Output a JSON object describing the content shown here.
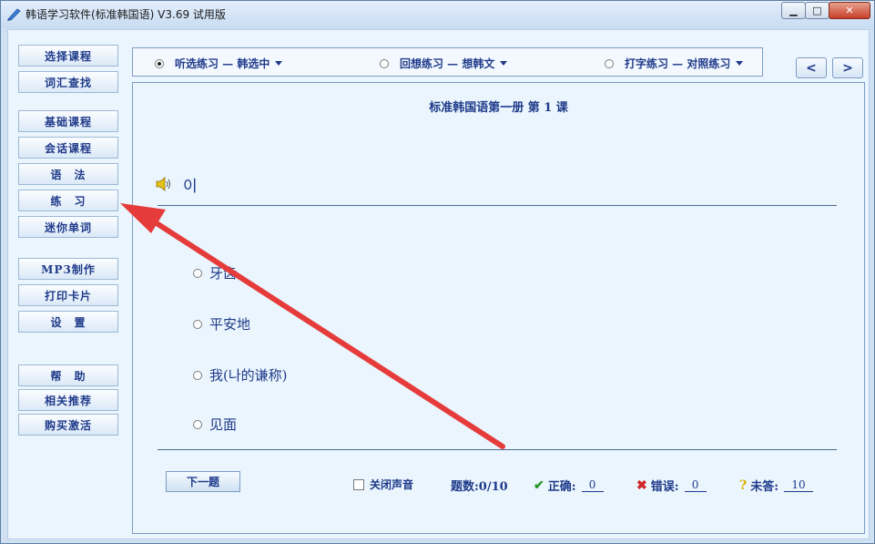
{
  "window": {
    "title": "韩语学习软件(标准韩国语) V3.69 试用版",
    "minimize": "▁",
    "maximize": "□",
    "close": "✕"
  },
  "sidebar": {
    "items": [
      {
        "label": "选择课程"
      },
      {
        "label": "词汇查找"
      },
      {
        "label": "基础课程"
      },
      {
        "label": "会话课程"
      },
      {
        "label": "语　法"
      },
      {
        "label": "练　习"
      },
      {
        "label": "迷你单词"
      },
      {
        "label": "MP3制作"
      },
      {
        "label": "打印卡片"
      },
      {
        "label": "设　置"
      },
      {
        "label": "帮　助"
      },
      {
        "label": "相关推荐"
      },
      {
        "label": "购买激活"
      }
    ]
  },
  "modes": [
    {
      "label": "听选练习 — 韩选中",
      "checked": true
    },
    {
      "label": "回想练习 — 想韩文",
      "checked": false
    },
    {
      "label": "打字练习 — 对照练习",
      "checked": false
    }
  ],
  "nav": {
    "prev": "<",
    "next": ">"
  },
  "main": {
    "lesson_title": "标准韩国语第一册 第 1 课",
    "question_word": "이",
    "choices": [
      "牙齿",
      "平安地",
      "我(나的谦称)",
      "见面"
    ]
  },
  "footer": {
    "next_label": "下一题",
    "mute_label": "关闭声音",
    "count_label": "题数:0/10",
    "correct_label": "正确:",
    "correct_value": "0",
    "wrong_label": "错误:",
    "wrong_value": "0",
    "unanswered_label": "未答:",
    "unanswered_value": "10"
  },
  "colors": {
    "accent_text": "#1f3a8a",
    "annotation_arrow": "#e63b3b",
    "correct_icon": "#2a9a2a",
    "wrong_icon": "#d0262a",
    "unanswered_icon": "#e0b000"
  }
}
